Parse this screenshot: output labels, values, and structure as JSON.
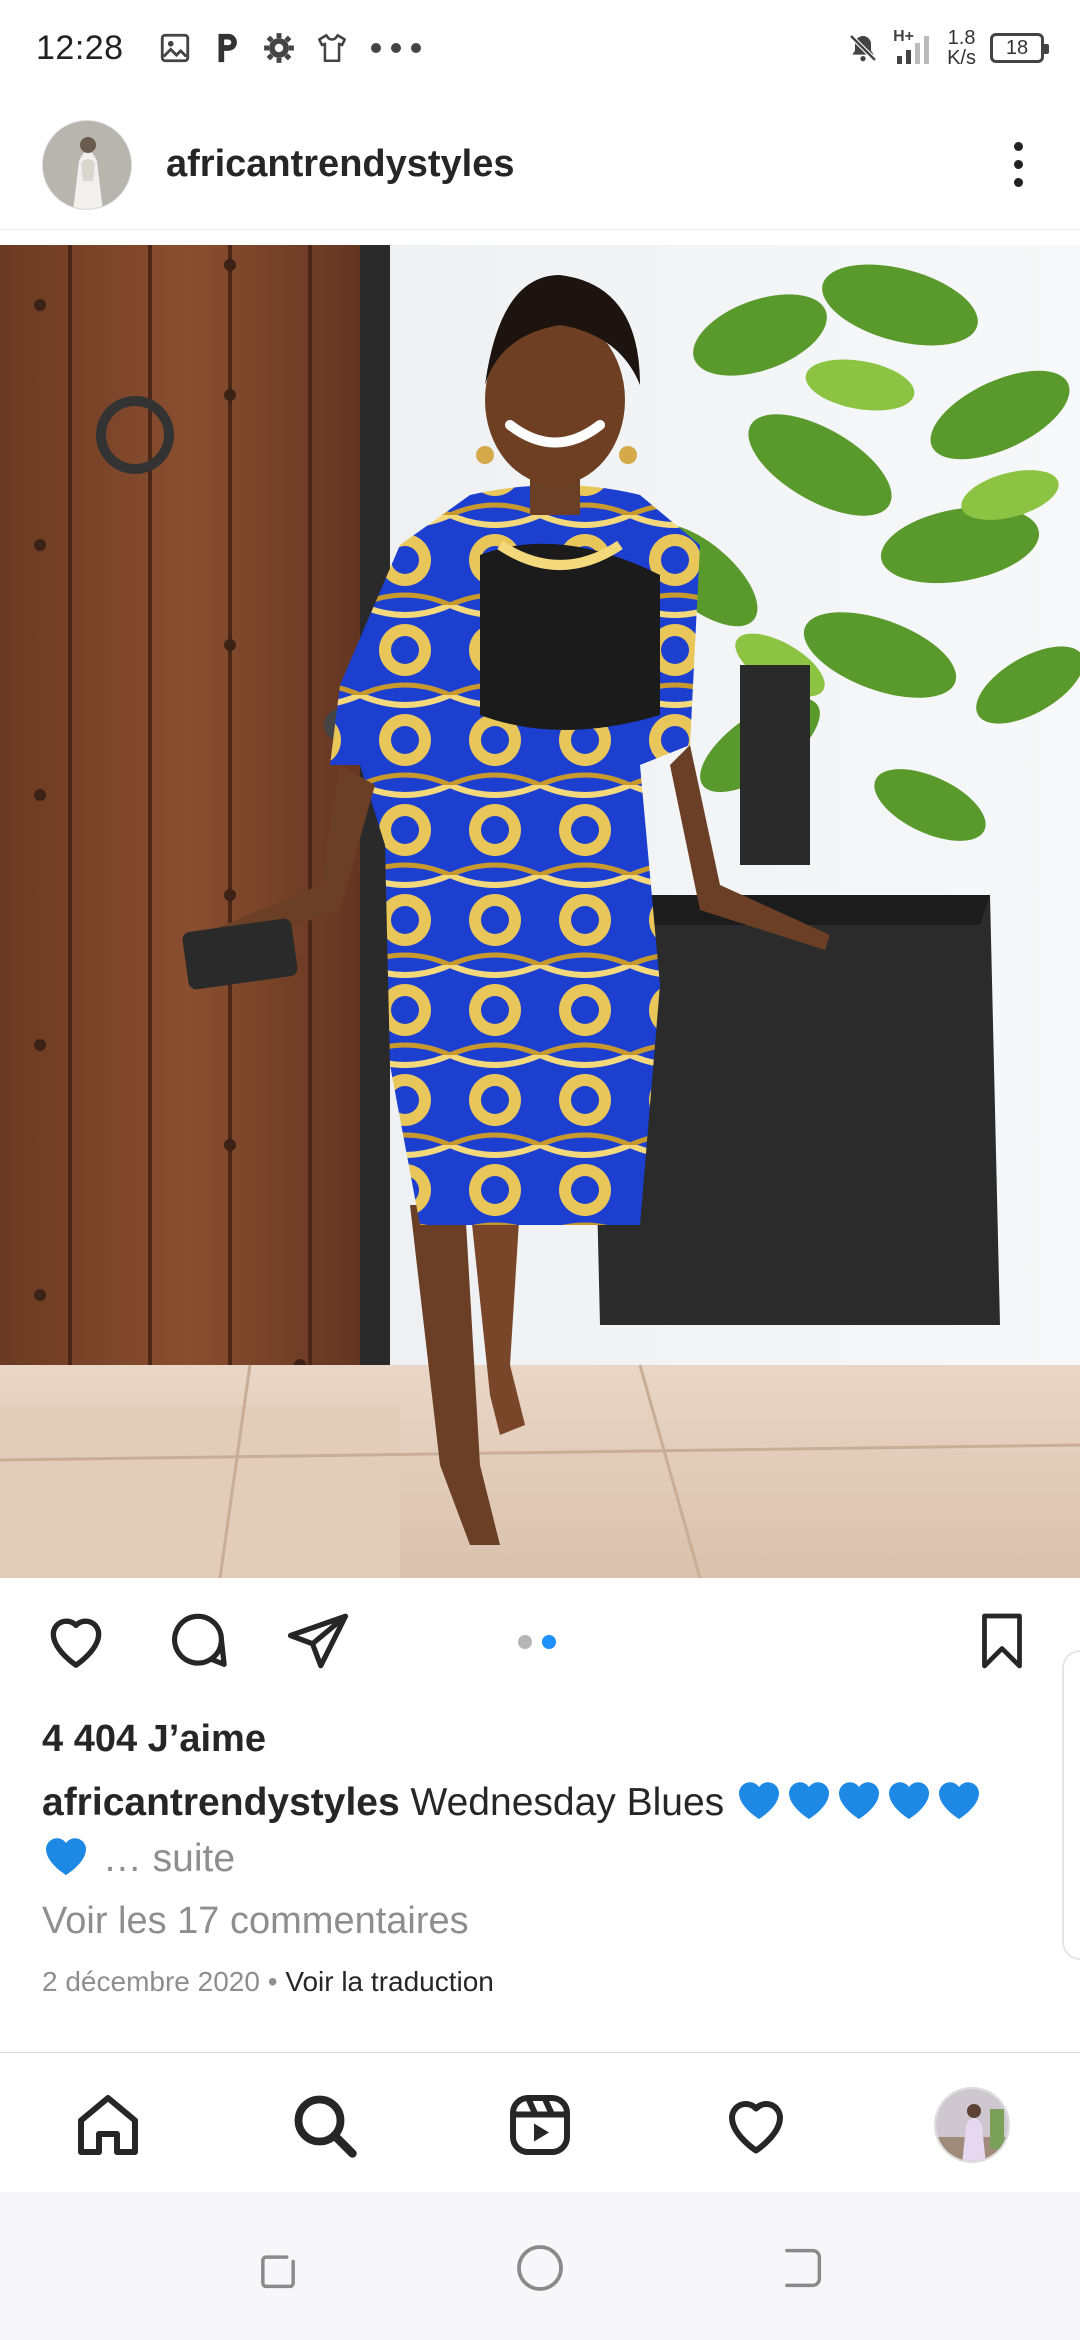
{
  "status_bar": {
    "time": "12:28",
    "icons_left": [
      "image-icon",
      "p-icon",
      "gear-icon",
      "shirt-icon",
      "more-dots-icon"
    ],
    "network_type": "H+",
    "speed_value": "1.8",
    "speed_unit": "K/s",
    "battery": "18"
  },
  "header": {
    "username": "africantrendystyles",
    "more_icon": "more-vertical-icon"
  },
  "post": {
    "carousel_count": 2,
    "carousel_active": 2
  },
  "actions": {
    "like_icon": "heart-icon",
    "comment_icon": "comment-icon",
    "share_icon": "send-icon",
    "save_icon": "bookmark-icon"
  },
  "likes": "4 404 J’aime",
  "caption": {
    "username": "africantrendystyles",
    "text": "Wednesday Blues",
    "more": "… suite"
  },
  "comments_link": "Voir les 17 commentaires",
  "meta": {
    "date": "2 décembre 2020",
    "separator": " • ",
    "translate": "Voir la traduction"
  },
  "bottom_nav": {
    "items": [
      "home-icon",
      "search-icon",
      "reels-icon",
      "activity-heart-icon",
      "profile-avatar"
    ]
  },
  "system_nav": {
    "items": [
      "recents-button",
      "home-button",
      "back-button"
    ]
  },
  "colors": {
    "text": "#262626",
    "muted": "#8e8e8e",
    "accent_blue": "#1e90ff",
    "heart_emoji": "#1e88e5"
  }
}
